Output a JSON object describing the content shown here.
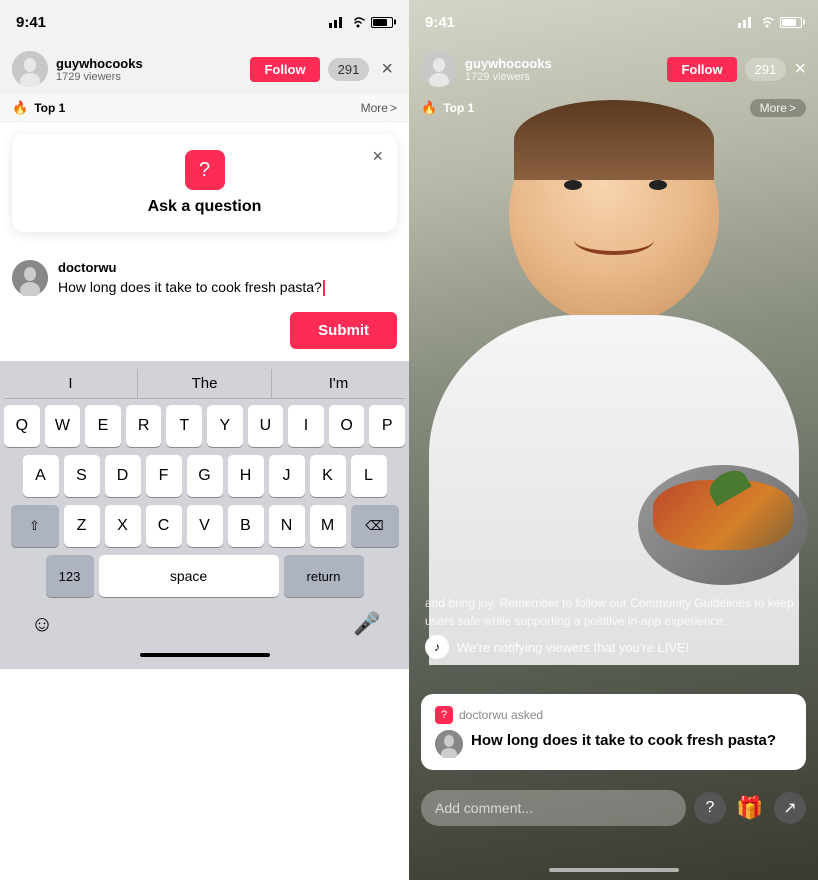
{
  "left_phone": {
    "status": {
      "time": "9:41",
      "signal": "▲▲▲",
      "wifi": "WiFi",
      "battery": "Battery"
    },
    "top_bar": {
      "username": "guywhocooks",
      "viewers": "1729 viewers",
      "follow_label": "Follow",
      "viewer_count": "291",
      "close": "×"
    },
    "trending_bar": {
      "fire": "🔥",
      "top_label": "Top 1",
      "more_label": "More",
      "more_arrow": ">"
    },
    "modal": {
      "close": "×",
      "icon_symbol": "?",
      "title": "Ask a question"
    },
    "question": {
      "username": "doctorwu",
      "text": "How long does it take to cook fresh pasta?"
    },
    "submit_label": "Submit",
    "keyboard": {
      "suggestions": [
        "I",
        "The",
        "I'm"
      ],
      "row1": [
        "Q",
        "W",
        "E",
        "R",
        "T",
        "Y",
        "U",
        "I",
        "O",
        "P"
      ],
      "row2": [
        "A",
        "S",
        "D",
        "F",
        "G",
        "H",
        "J",
        "K",
        "L"
      ],
      "row3": [
        "Z",
        "X",
        "C",
        "V",
        "B",
        "N",
        "M"
      ],
      "shift": "⇧",
      "delete": "⌫",
      "num_label": "123",
      "space_label": "space",
      "return_label": "return"
    }
  },
  "right_phone": {
    "status": {
      "time": "9:41"
    },
    "top_bar": {
      "username": "guywhocooks",
      "viewers": "1729 viewers",
      "follow_label": "Follow",
      "viewer_count": "291",
      "close": "×"
    },
    "trending_bar": {
      "fire": "🔥",
      "top_label": "Top 1",
      "more_label": "More",
      "more_arrow": ">"
    },
    "guidelines_text": "and bring joy. Remember to follow our Community Guidelines to keep users safe while supporting a positive in-app experience.",
    "notification_text": "We're notifying viewers that you're LIVE!",
    "question_card": {
      "asked_by": "doctorwu asked",
      "question": "How long does it take to cook fresh pasta?"
    },
    "comment_placeholder": "Add comment...",
    "icons": {
      "question_icon": "?",
      "gift_icon": "🎁",
      "share_icon": "↗"
    }
  }
}
